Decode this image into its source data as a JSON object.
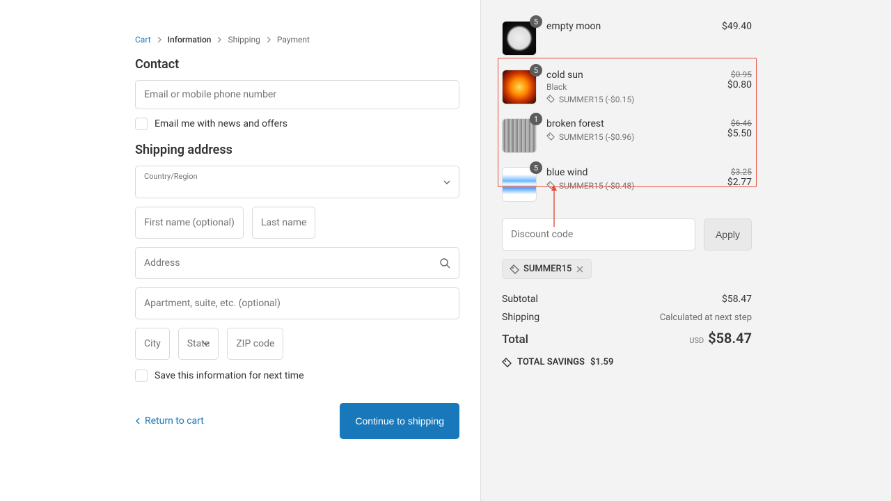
{
  "breadcrumb": [
    {
      "label": "Cart",
      "kind": "link"
    },
    {
      "label": "Information",
      "kind": "current"
    },
    {
      "label": "Shipping",
      "kind": "future"
    },
    {
      "label": "Payment",
      "kind": "future"
    }
  ],
  "contact": {
    "heading": "Contact",
    "email_placeholder": "Email or mobile phone number",
    "email_value": "",
    "news_opt_in_label": "Email me with news and offers"
  },
  "shipping": {
    "heading": "Shipping address",
    "country_label": "Country/Region",
    "country_value": "",
    "first_name_placeholder": "First name (optional)",
    "first_name_value": "",
    "last_name_placeholder": "Last name",
    "last_name_value": "",
    "address_placeholder": "Address",
    "address_value": "",
    "apt_placeholder": "Apartment, suite, etc. (optional)",
    "apt_value": "",
    "city_placeholder": "City",
    "city_value": "",
    "state_placeholder": "State",
    "state_value": "",
    "zip_placeholder": "ZIP code",
    "zip_value": "",
    "save_info_label": "Save this information for next time"
  },
  "nav": {
    "return_label": "Return to cart",
    "continue_label": "Continue to shipping"
  },
  "cart": {
    "items": [
      {
        "qty": "5",
        "title": "empty moon",
        "variant": "",
        "discount_tag": "",
        "compare_price": "",
        "price": "$49.40",
        "thumb": "moon"
      },
      {
        "qty": "5",
        "title": "cold sun",
        "variant": "Black",
        "discount_tag": "SUMMER15 (-$0.15)",
        "compare_price": "$0.95",
        "price": "$0.80",
        "thumb": "sun"
      },
      {
        "qty": "1",
        "title": "broken forest",
        "variant": "",
        "discount_tag": "SUMMER15 (-$0.96)",
        "compare_price": "$6.46",
        "price": "$5.50",
        "thumb": "forest"
      },
      {
        "qty": "5",
        "title": "blue wind",
        "variant": "",
        "discount_tag": "SUMMER15 (-$0.48)",
        "compare_price": "$3.25",
        "price": "$2.77",
        "thumb": "wind"
      }
    ],
    "discount_placeholder": "Discount code",
    "apply_label": "Apply",
    "applied_code": "SUMMER15",
    "subtotal_label": "Subtotal",
    "subtotal_value": "$58.47",
    "shipping_label": "Shipping",
    "shipping_value": "Calculated at next step",
    "total_label": "Total",
    "total_currency": "USD",
    "total_value": "$58.47",
    "savings_label": "TOTAL SAVINGS",
    "savings_value": "$1.59"
  },
  "annotation": {
    "highlight_item_start": 1,
    "highlight_item_end": 3,
    "arrow_points_to": "discounted-items"
  }
}
